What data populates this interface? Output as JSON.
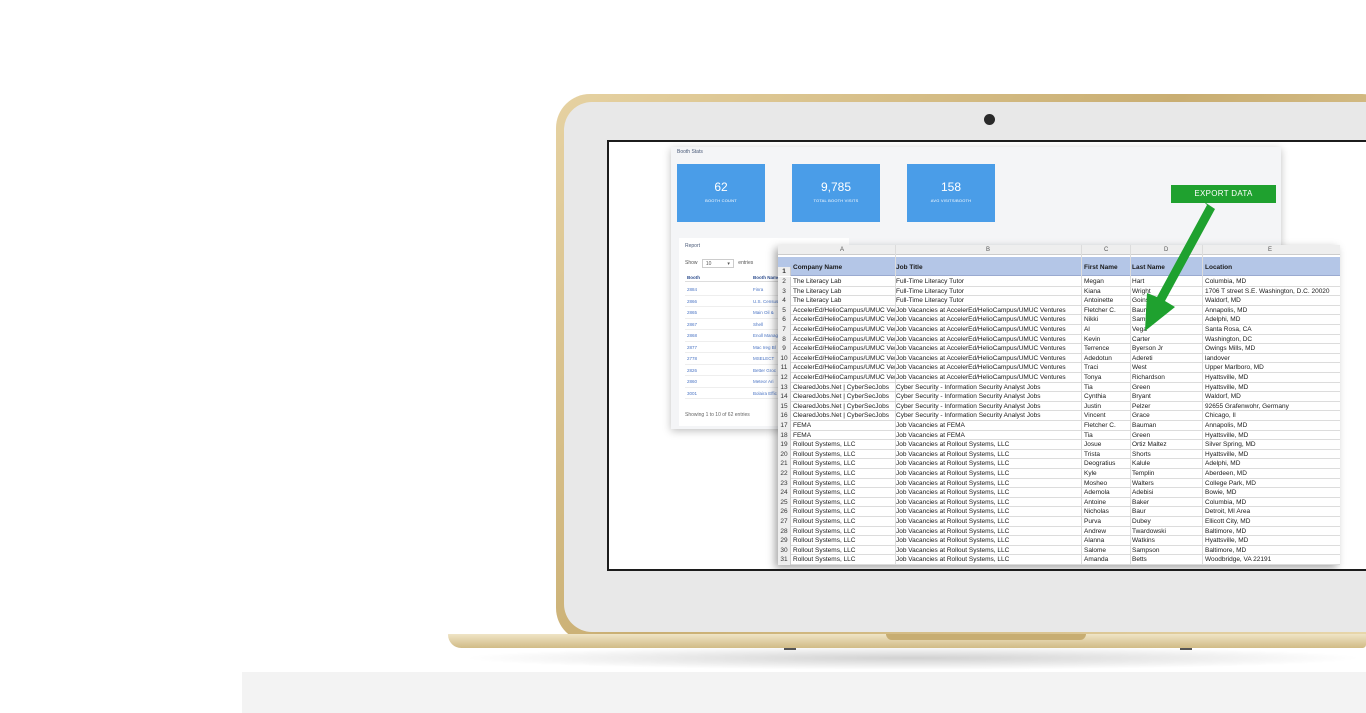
{
  "dashboard": {
    "section_title": "Booth Stats",
    "cards": [
      {
        "value": "62",
        "label": "BOOTH COUNT"
      },
      {
        "value": "9,785",
        "label": "TOTAL BOOTH VISITS"
      },
      {
        "value": "158",
        "label": "AVG VISITS/BOOTH"
      }
    ],
    "export_label": "EXPORT DATA",
    "report": {
      "title": "Report",
      "show_label": "Show",
      "show_value": "10",
      "entries_label": "entries",
      "columns": [
        "Booth",
        "Booth Name"
      ],
      "rows": [
        [
          "2884",
          "Finra"
        ],
        [
          "2866",
          "U.S. Census"
        ],
        [
          "2865",
          "Main Oil &"
        ],
        [
          "2867",
          "Shell"
        ],
        [
          "2868",
          "Enoll Manage"
        ],
        [
          "2877",
          "Mac Ireg Bl"
        ],
        [
          "2778",
          "MSELECT"
        ],
        [
          "2826",
          "Better Groc"
        ],
        [
          "2860",
          "Meteor Ari"
        ],
        [
          "3001",
          "Bolaira Effic"
        ]
      ],
      "footer": "Showing 1 to 10 of 62 entries"
    }
  },
  "spreadsheet": {
    "column_letters": [
      "A",
      "B",
      "C",
      "D",
      "E"
    ],
    "header_row_number": "1",
    "headers": [
      "Company Name",
      "Job Title",
      "First Name",
      "Last Name",
      "Location"
    ],
    "rows": [
      [
        "2",
        "The Literacy Lab",
        "Full-Time Literacy Tutor",
        "Megan",
        "Hart",
        "Columbia, MD"
      ],
      [
        "3",
        "The Literacy Lab",
        "Full-Time Literacy Tutor",
        "Kiana",
        "Wright",
        "1706 T street S.E. Washington, D.C. 20020"
      ],
      [
        "4",
        "The Literacy Lab",
        "Full-Time Literacy Tutor",
        "Antoinette",
        "Goins",
        "Waldorf, MD"
      ],
      [
        "5",
        "AccelerEd/HelioCampus/UMUC Ventures",
        "Job Vacancies at AccelerEd/HelioCampus/UMUC Ventures",
        "Fletcher C.",
        "Bauman",
        "Annapolis, MD"
      ],
      [
        "6",
        "AccelerEd/HelioCampus/UMUC Ventures",
        "Job Vacancies at AccelerEd/HelioCampus/UMUC Ventures",
        "Nikki",
        "Sams",
        "Adelphi, MD"
      ],
      [
        "7",
        "AccelerEd/HelioCampus/UMUC Ventures",
        "Job Vacancies at AccelerEd/HelioCampus/UMUC Ventures",
        "Al",
        "Vega",
        "Santa Rosa, CA"
      ],
      [
        "8",
        "AccelerEd/HelioCampus/UMUC Ventures",
        "Job Vacancies at AccelerEd/HelioCampus/UMUC Ventures",
        "Kevin",
        "Carter",
        "Washington, DC"
      ],
      [
        "9",
        "AccelerEd/HelioCampus/UMUC Ventures",
        "Job Vacancies at AccelerEd/HelioCampus/UMUC Ventures",
        "Terrence",
        "Byerson Jr",
        "Owings Mills, MD"
      ],
      [
        "10",
        "AccelerEd/HelioCampus/UMUC Ventures",
        "Job Vacancies at AccelerEd/HelioCampus/UMUC Ventures",
        "Adedotun",
        "Adereti",
        "landover"
      ],
      [
        "11",
        "AccelerEd/HelioCampus/UMUC Ventures",
        "Job Vacancies at AccelerEd/HelioCampus/UMUC Ventures",
        "Traci",
        "West",
        "Upper Marlboro, MD"
      ],
      [
        "12",
        "AccelerEd/HelioCampus/UMUC Ventures",
        "Job Vacancies at AccelerEd/HelioCampus/UMUC Ventures",
        "Tonya",
        "Richardson",
        "Hyattsville, MD"
      ],
      [
        "13",
        "ClearedJobs.Net | CyberSecJobs",
        "Cyber Security - Information Security Analyst Jobs",
        "Tia",
        "Green",
        "Hyattsville, MD"
      ],
      [
        "14",
        "ClearedJobs.Net | CyberSecJobs",
        "Cyber Security - Information Security Analyst Jobs",
        "Cynthia",
        "Bryant",
        "Waldorf, MD"
      ],
      [
        "15",
        "ClearedJobs.Net | CyberSecJobs",
        "Cyber Security - Information Security Analyst Jobs",
        "Justin",
        "Pelzer",
        "92655 Grafenwohr, Germany"
      ],
      [
        "16",
        "ClearedJobs.Net | CyberSecJobs",
        "Cyber Security - Information Security Analyst Jobs",
        "Vincent",
        "Grace",
        "Chicago, Il"
      ],
      [
        "17",
        "FEMA",
        "Job Vacancies at FEMA",
        "Fletcher C.",
        "Bauman",
        "Annapolis, MD"
      ],
      [
        "18",
        "FEMA",
        "Job Vacancies at FEMA",
        "Tia",
        "Green",
        "Hyattsville, MD"
      ],
      [
        "19",
        "Rollout Systems, LLC",
        "Job Vacancies at Rollout Systems, LLC",
        "Josue",
        "Ortiz Maltez",
        "Silver Spring, MD"
      ],
      [
        "20",
        "Rollout Systems, LLC",
        "Job Vacancies at Rollout Systems, LLC",
        "Trista",
        "Shorts",
        "Hyattsville, MD"
      ],
      [
        "21",
        "Rollout Systems, LLC",
        "Job Vacancies at Rollout Systems, LLC",
        "Deogratius",
        "Kalule",
        "Adelphi, MD"
      ],
      [
        "22",
        "Rollout Systems, LLC",
        "Job Vacancies at Rollout Systems, LLC",
        "Kyle",
        "Templin",
        "Aberdeen, MD"
      ],
      [
        "23",
        "Rollout Systems, LLC",
        "Job Vacancies at Rollout Systems, LLC",
        "Mosheo",
        "Walters",
        "College Park, MD"
      ],
      [
        "24",
        "Rollout Systems, LLC",
        "Job Vacancies at Rollout Systems, LLC",
        "Ademola",
        "Adebisi",
        "Bowie, MD"
      ],
      [
        "25",
        "Rollout Systems, LLC",
        "Job Vacancies at Rollout Systems, LLC",
        "Antoine",
        "Baker",
        "Columbia, MD"
      ],
      [
        "26",
        "Rollout Systems, LLC",
        "Job Vacancies at Rollout Systems, LLC",
        "Nicholas",
        "Baur",
        "Detroit, MI Area"
      ],
      [
        "27",
        "Rollout Systems, LLC",
        "Job Vacancies at Rollout Systems, LLC",
        "Purva",
        "Dubey",
        "Ellicott City, MD"
      ],
      [
        "28",
        "Rollout Systems, LLC",
        "Job Vacancies at Rollout Systems, LLC",
        "Andrew",
        "Twardowski",
        "Baltimore, MD"
      ],
      [
        "29",
        "Rollout Systems, LLC",
        "Job Vacancies at Rollout Systems, LLC",
        "Alanna",
        "Watkins",
        "Hyattsville, MD"
      ],
      [
        "30",
        "Rollout Systems, LLC",
        "Job Vacancies at Rollout Systems, LLC",
        "Salome",
        "Sampson",
        "Baltimore, MD"
      ],
      [
        "31",
        "Rollout Systems, LLC",
        "Job Vacancies at Rollout Systems, LLC",
        "Amanda",
        "Betts",
        "Woodbridge, VA 22191"
      ]
    ]
  },
  "colors": {
    "card_blue": "#4a9de8",
    "export_green": "#1fa12f",
    "header_blue": "#b4c6e7",
    "laptop_gold": "#c9ae72"
  },
  "icons": [
    "camera-icon",
    "green-arrow-icon",
    "dropdown-caret-icon"
  ]
}
